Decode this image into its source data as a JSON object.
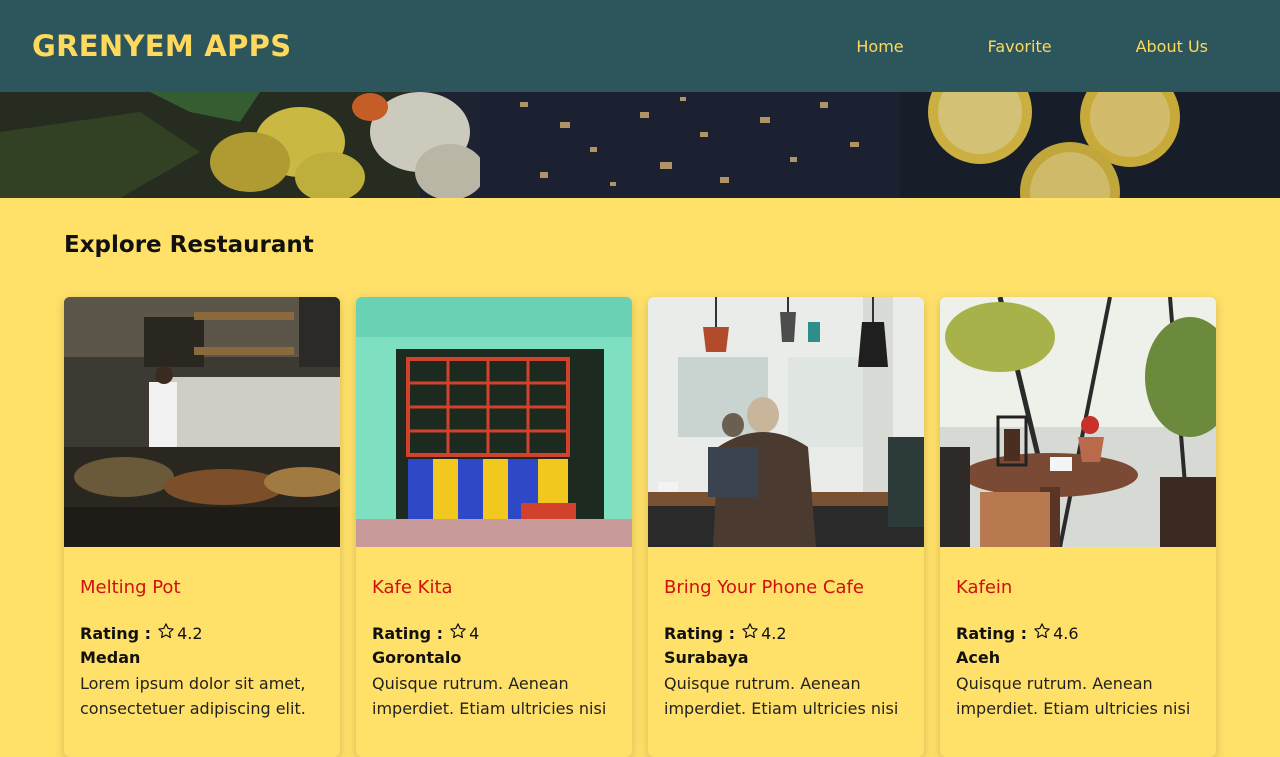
{
  "header": {
    "brand": "GRENYEM APPS",
    "nav": [
      "Home",
      "Favorite",
      "About Us"
    ]
  },
  "section": {
    "title": "Explore Restaurant"
  },
  "labels": {
    "rating": "Rating :"
  },
  "restaurants": [
    {
      "name": "Melting Pot",
      "rating": "4.2",
      "city": "Medan",
      "description": "Lorem ipsum dolor sit amet, consectetuer adipiscing elit."
    },
    {
      "name": "Kafe Kita",
      "rating": "4",
      "city": "Gorontalo",
      "description": "Quisque rutrum. Aenean imperdiet. Etiam ultricies nisi"
    },
    {
      "name": "Bring Your Phone Cafe",
      "rating": "4.2",
      "city": "Surabaya",
      "description": "Quisque rutrum. Aenean imperdiet. Etiam ultricies nisi"
    },
    {
      "name": "Kafein",
      "rating": "4.6",
      "city": "Aceh",
      "description": "Quisque rutrum. Aenean imperdiet. Etiam ultricies nisi"
    }
  ],
  "colors": {
    "header_bg": "#2d565c",
    "brand": "#ffd85e",
    "page_bg": "#ffe169",
    "card_title": "#d10f0f"
  },
  "icons": {
    "rating": "star-outline-icon"
  }
}
